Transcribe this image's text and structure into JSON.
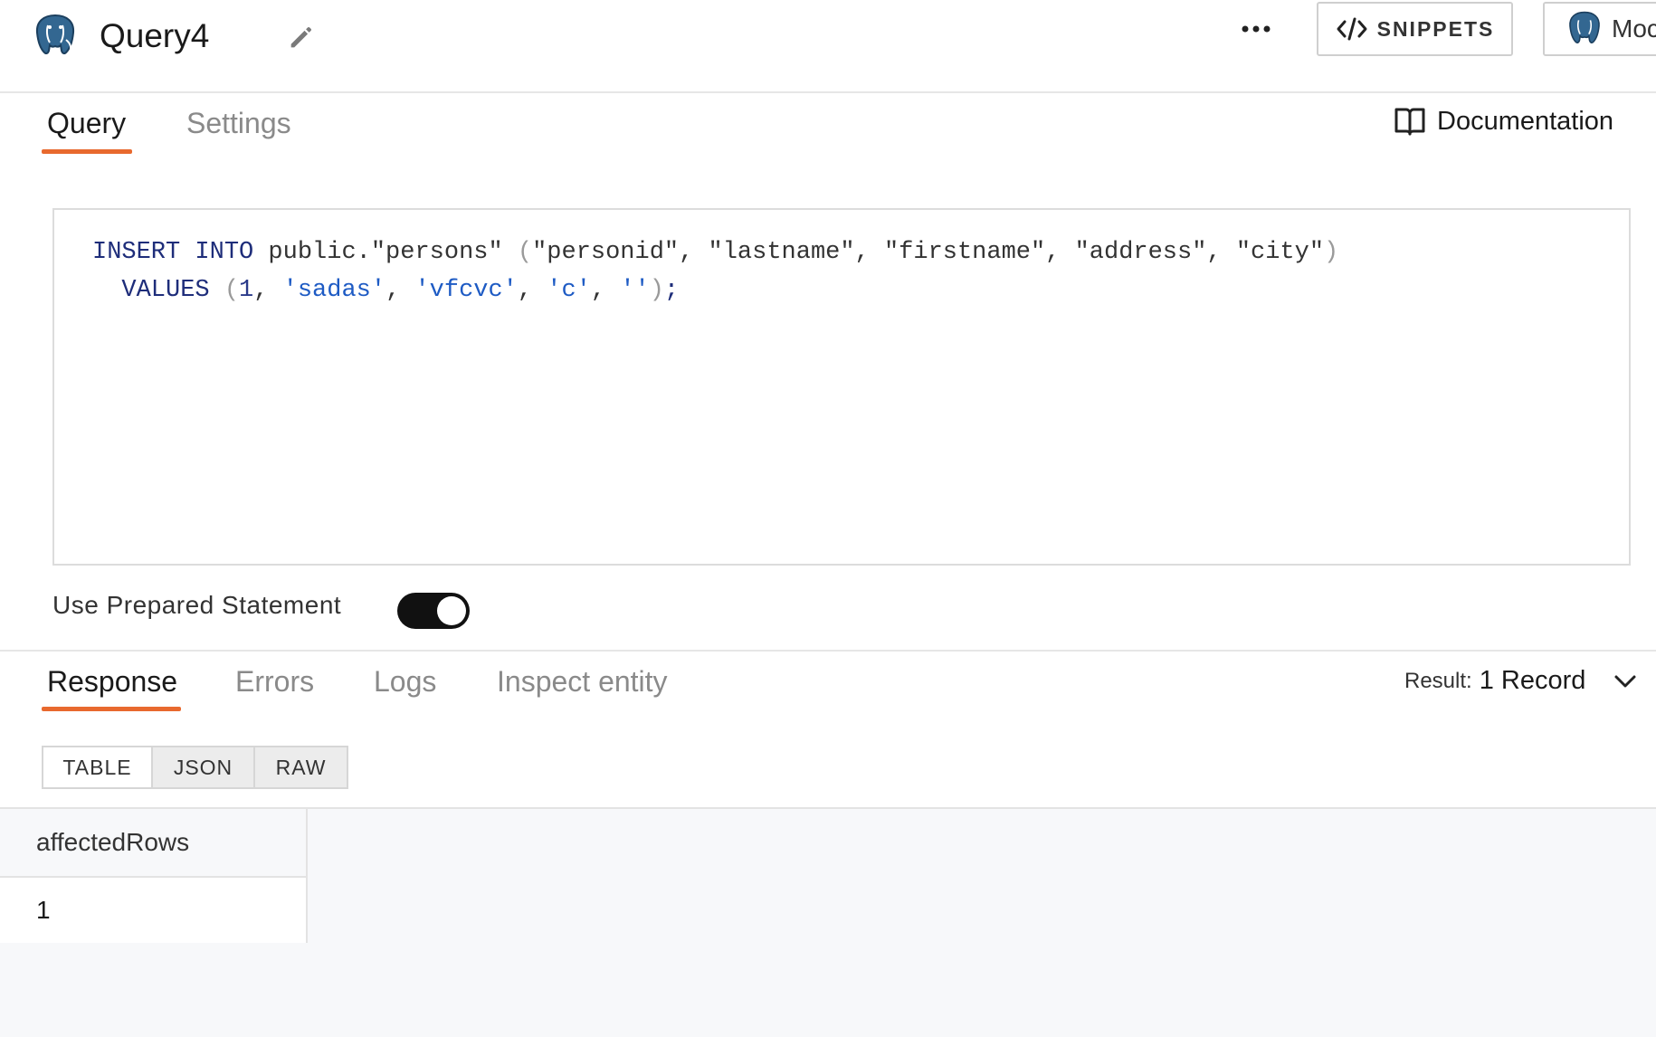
{
  "header": {
    "query_name": "Query4",
    "snippets_label": "SNIPPETS",
    "datasource_label": "Moc"
  },
  "tabs_top": [
    {
      "label": "Query",
      "active": true
    },
    {
      "label": "Settings",
      "active": false
    }
  ],
  "documentation_label": "Documentation",
  "editor": {
    "line1": {
      "kw1": "INSERT INTO",
      "target": " public.\"persons\" ",
      "open": "(",
      "cols": "\"personid\", \"lastname\", \"firstname\", \"address\", \"city\"",
      "close": ")"
    },
    "line2": {
      "indent": "  ",
      "kw": "VALUES",
      "open": "(",
      "num": "1",
      "sep1": ", ",
      "s1": "'sadas'",
      "sep2": ", ",
      "s2": "'vfcvc'",
      "sep3": ", ",
      "s3": "'c'",
      "sep4": ", ",
      "s4": "''",
      "close": ")",
      "end": ";"
    }
  },
  "prepared_statement": {
    "label": "Use Prepared Statement",
    "enabled": true
  },
  "tabs_bottom": [
    {
      "label": "Response",
      "active": true
    },
    {
      "label": "Errors",
      "active": false
    },
    {
      "label": "Logs",
      "active": false
    },
    {
      "label": "Inspect entity",
      "active": false
    }
  ],
  "result": {
    "prefix": "Result:",
    "value": "1 Record"
  },
  "format_buttons": [
    {
      "label": "TABLE",
      "active": true
    },
    {
      "label": "JSON",
      "active": false
    },
    {
      "label": "RAW",
      "active": false
    }
  ],
  "table": {
    "columns": [
      "affectedRows"
    ],
    "rows": [
      [
        "1"
      ]
    ]
  },
  "colors": {
    "accent": "#e8692e",
    "toggle_on": "#111111",
    "keyword": "#1e2d7a",
    "string": "#1e5bc4"
  }
}
